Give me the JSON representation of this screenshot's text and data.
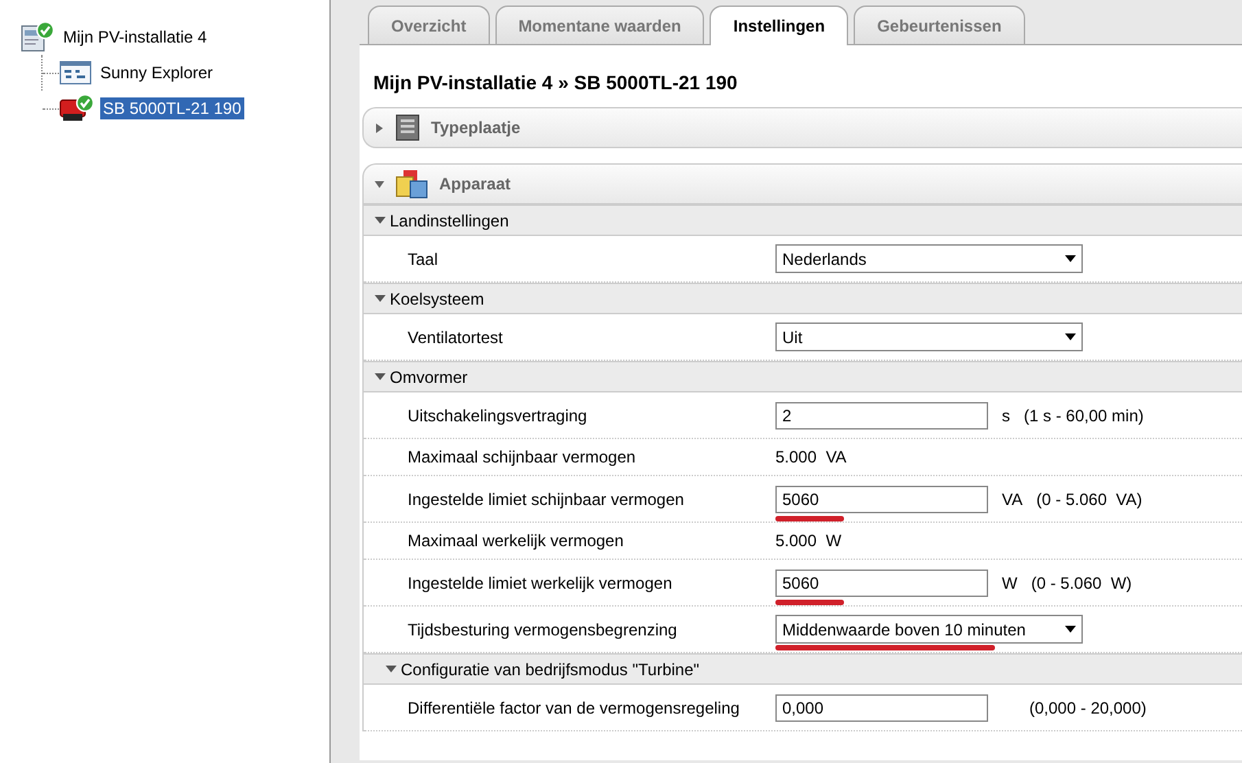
{
  "tree": {
    "label": "Mijn PV-installatie 4",
    "selected": false,
    "online": true,
    "children": [
      {
        "label": "Sunny Explorer",
        "kind": "app",
        "selected": false
      },
      {
        "label": "SB 5000TL-21 190",
        "kind": "inverter",
        "online": true,
        "selected": true
      }
    ]
  },
  "tabs": [
    {
      "label": "Overzicht",
      "selected": false
    },
    {
      "label": "Momentane waarden",
      "selected": false
    },
    {
      "label": "Instellingen",
      "selected": true
    },
    {
      "label": "Gebeurtenissen",
      "selected": false
    }
  ],
  "title": "Mijn PV-installatie 4 » SB 5000TL-21 190",
  "panels": [
    {
      "label": "Typeplaatje",
      "kind": "nameplate",
      "expanded": false
    },
    {
      "label": "Apparaat",
      "kind": "device",
      "expanded": true
    }
  ],
  "sections": [
    {
      "label": "Landinstellingen",
      "expanded": true,
      "rows": [
        {
          "kind": "select",
          "label": "Taal",
          "value": "Nederlands",
          "highlighted": false
        }
      ]
    },
    {
      "label": "Koelsysteem",
      "expanded": true,
      "rows": [
        {
          "kind": "select",
          "label": "Ventilatortest",
          "value": "Uit",
          "highlighted": false
        }
      ]
    },
    {
      "label": "Omvormer",
      "expanded": true,
      "rows": [
        {
          "kind": "input",
          "label": "Uitschakelingsvertraging",
          "value": "2",
          "unit": "s",
          "range": "(1 s - 60,00 min)",
          "highlighted": false
        },
        {
          "kind": "readonly",
          "label": "Maximaal schijnbaar vermogen",
          "value": "5.000  VA"
        },
        {
          "kind": "input",
          "label": "Ingestelde limiet schijnbaar vermogen",
          "value": "5060",
          "unit": "VA",
          "range": "(0 - 5.060  VA)",
          "highlighted": true
        },
        {
          "kind": "readonly",
          "label": "Maximaal werkelijk vermogen",
          "value": "5.000  W"
        },
        {
          "kind": "input",
          "label": "Ingestelde limiet werkelijk vermogen",
          "value": "5060",
          "unit": "W",
          "range": "(0 - 5.060  W)",
          "highlighted": true
        },
        {
          "kind": "select",
          "label": "Tijdsbesturing vermogensbegrenzing",
          "value": "Middenwaarde boven 10 minuten",
          "highlighted": true
        }
      ],
      "children": [
        {
          "label": "Configuratie van bedrijfsmodus \"Turbine\"",
          "expanded": true,
          "rows": [
            {
              "kind": "input",
              "label": "Differentiële factor van de vermogensregeling",
              "value": "0,000",
              "range": "(0,000 - 20,000)",
              "highlighted": false
            }
          ]
        }
      ]
    }
  ]
}
